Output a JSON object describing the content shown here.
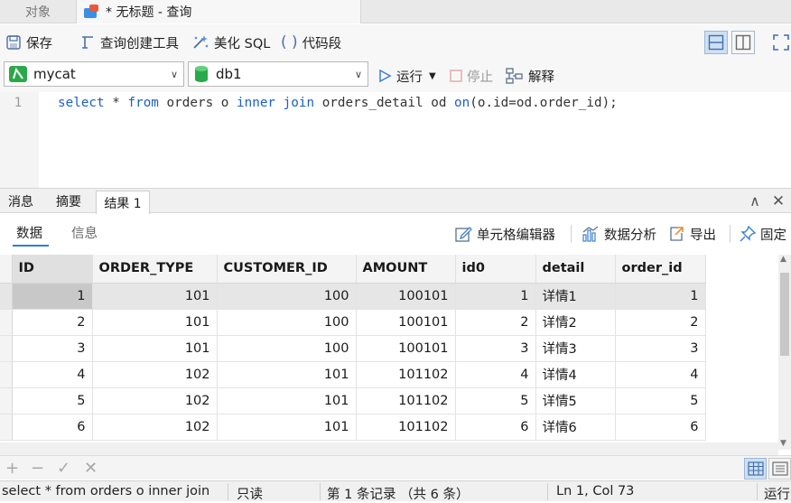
{
  "tabs": {
    "objects": "对象",
    "query": "* 无标题 - 查询"
  },
  "toolbar": {
    "save": "保存",
    "query_builder": "查询创建工具",
    "beautify_sql": "美化 SQL",
    "code_snippet": "代码段"
  },
  "connection": {
    "name": "mycat",
    "database": "db1",
    "run": "运行",
    "stop": "停止",
    "explain": "解释"
  },
  "editor": {
    "line_number": "1",
    "tokens": [
      {
        "t": "select",
        "kw": true
      },
      {
        "t": " * ",
        "kw": false
      },
      {
        "t": "from",
        "kw": true
      },
      {
        "t": " orders o ",
        "kw": false
      },
      {
        "t": "inner",
        "kw": true
      },
      {
        "t": " ",
        "kw": false
      },
      {
        "t": "join",
        "kw": true
      },
      {
        "t": " orders_detail od ",
        "kw": false
      },
      {
        "t": "on",
        "kw": true
      },
      {
        "t": "(o.id=od.order_id);",
        "kw": false
      }
    ]
  },
  "bottom_tabs": {
    "messages": "消息",
    "summary": "摘要",
    "result": "结果 1"
  },
  "result_toolbar": {
    "data": "数据",
    "info": "信息",
    "cell_editor": "单元格编辑器",
    "data_analysis": "数据分析",
    "export": "导出",
    "pin": "固定"
  },
  "grid": {
    "columns": [
      "ID",
      "ORDER_TYPE",
      "CUSTOMER_ID",
      "AMOUNT",
      "id0",
      "detail",
      "order_id"
    ],
    "rows": [
      [
        "1",
        "101",
        "100",
        "100101",
        "1",
        "详情1",
        "1"
      ],
      [
        "2",
        "101",
        "100",
        "100101",
        "2",
        "详情2",
        "2"
      ],
      [
        "3",
        "101",
        "100",
        "100101",
        "3",
        "详情3",
        "3"
      ],
      [
        "4",
        "102",
        "101",
        "101102",
        "4",
        "详情4",
        "4"
      ],
      [
        "5",
        "102",
        "101",
        "101102",
        "5",
        "详情5",
        "5"
      ],
      [
        "6",
        "102",
        "101",
        "101102",
        "6",
        "详情6",
        "6"
      ]
    ],
    "selected_row": 0
  },
  "status": {
    "sql": "select * from orders o inner join",
    "mode": "只读",
    "record": "第 1 条记录 （共 6 条）",
    "position": "Ln 1, Col 73",
    "run_state": "运行"
  },
  "colors": {
    "accent": "#2d7fd3",
    "keyword": "#1c5fc9",
    "mycat_icon": "#2aa84a",
    "db_icon": "#2aa84a"
  }
}
